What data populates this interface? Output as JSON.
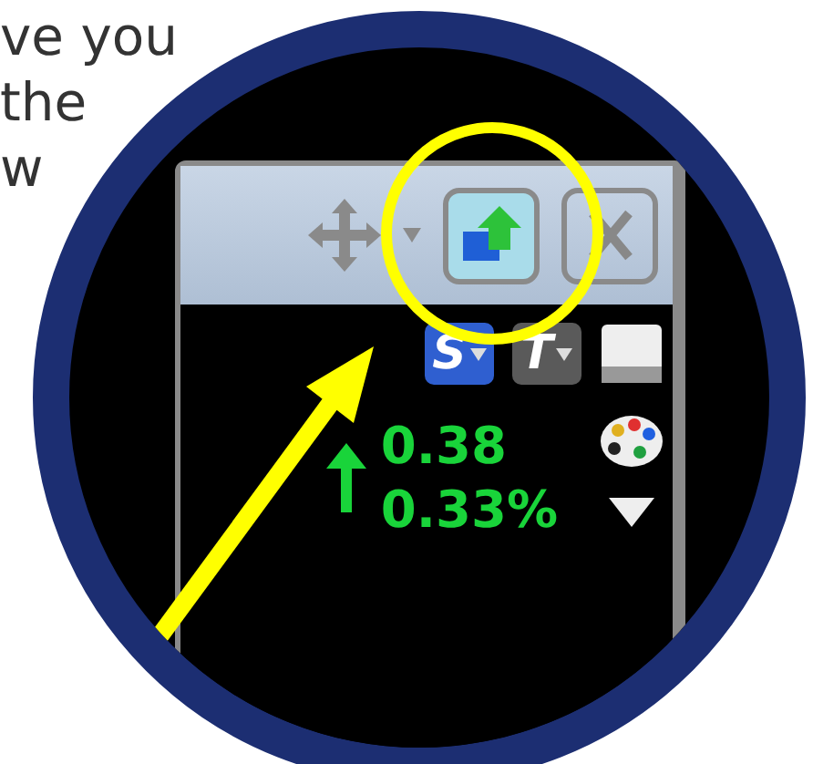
{
  "text_lines": [
    "ve you",
    "the",
    "w"
  ],
  "window": {
    "restore_button": {
      "highlighted": true
    },
    "toolbar": [
      {
        "kind": "menu",
        "label": "S",
        "color": "#2f5fd0"
      },
      {
        "kind": "menu",
        "label": "T",
        "color": "#5a5a5a"
      },
      {
        "kind": "icon"
      }
    ],
    "change": {
      "rising": true,
      "value": "0.38",
      "percent": "0.33%"
    }
  }
}
